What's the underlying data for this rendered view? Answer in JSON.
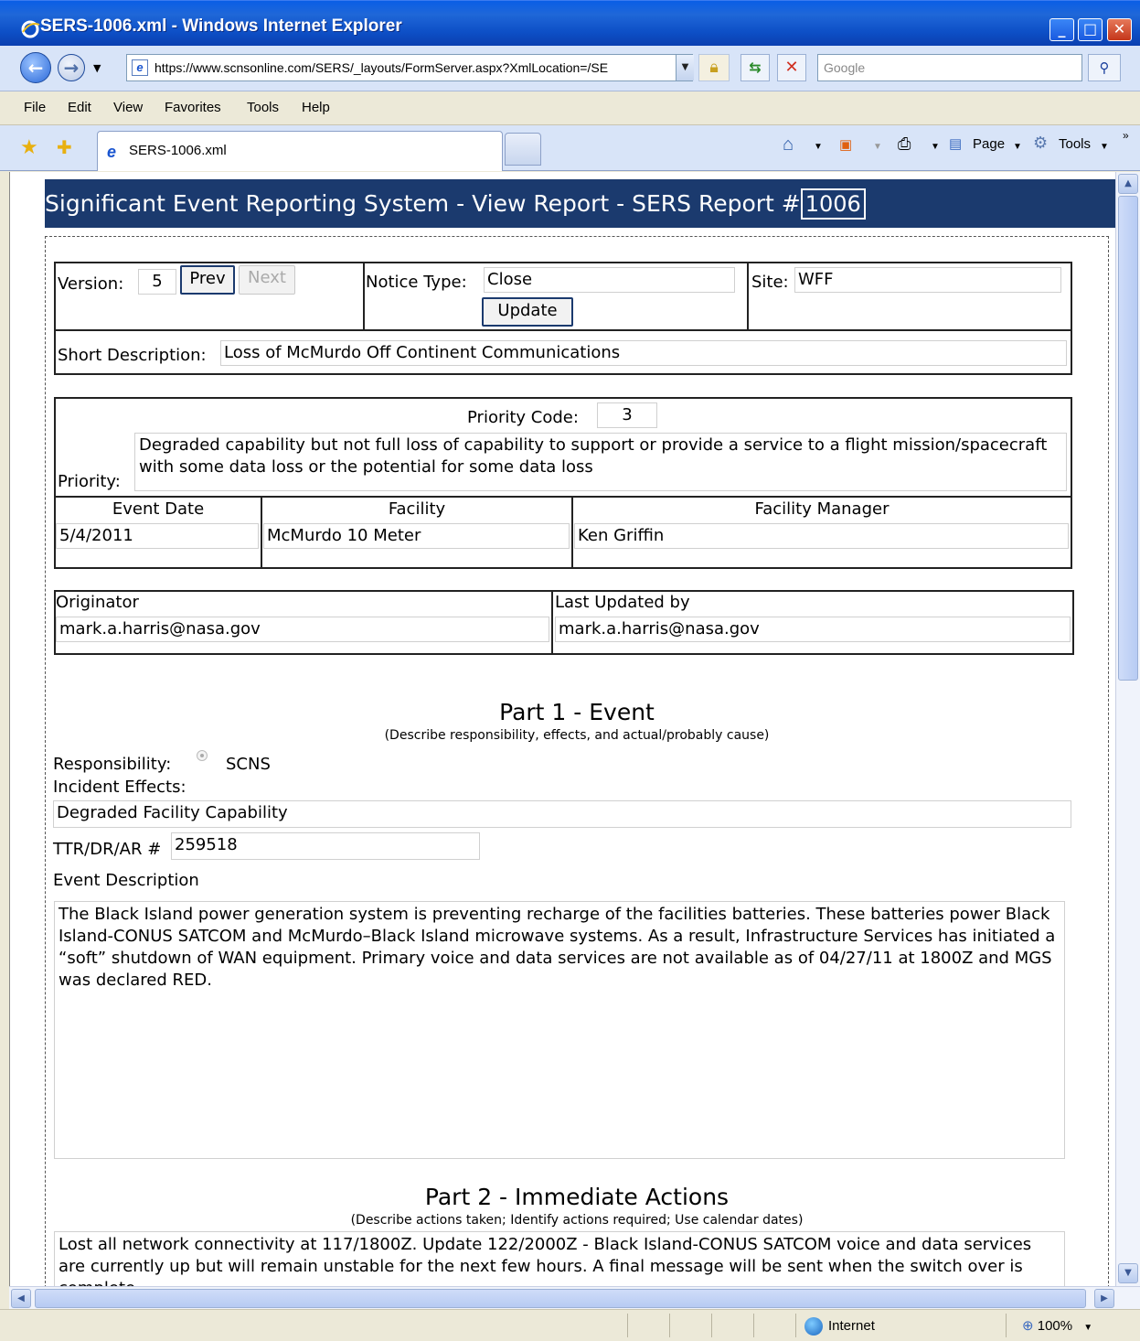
{
  "window": {
    "title": "SERS-1006.xml - Windows Internet Explorer",
    "min": "_",
    "max": "□",
    "close": "✕"
  },
  "address": {
    "url": "https://www.scnsonline.com/SERS/_layouts/FormServer.aspx?XmlLocation=/SE",
    "search_placeholder": "Google"
  },
  "menu": {
    "file": "File",
    "edit": "Edit",
    "view": "View",
    "favorites": "Favorites",
    "tools": "Tools",
    "help": "Help"
  },
  "tab": {
    "title": "SERS-1006.xml"
  },
  "commandbar": {
    "page": "Page",
    "tools": "Tools"
  },
  "status": {
    "zone": "Internet",
    "zoom": "100%"
  },
  "form": {
    "banner_prefix": "Significant Event Reporting System - View Report - SERS Report #",
    "report_number": "1006",
    "version_label": "Version:",
    "version": "5",
    "prev_label": "Prev",
    "next_label": "Next",
    "notice_type_label": "Notice Type:",
    "notice_type": "Close",
    "update_label": "Update",
    "site_label": "Site:",
    "site": "WFF",
    "short_desc_label": "Short Description:",
    "short_desc": "Loss of McMurdo Off Continent Communications",
    "priority_code_label": "Priority Code:",
    "priority_code": "3",
    "priority_label": "Priority:",
    "priority_text": "Degraded capability but not full loss of capability to support or provide a service to a flight mission/spacecraft with some data loss or the potential for some data loss",
    "event_date_label": "Event Date",
    "event_date": "5/4/2011",
    "facility_label": "Facility",
    "facility": "McMurdo 10 Meter",
    "facility_manager_label": "Facility Manager",
    "facility_manager": "Ken Griffin",
    "originator_label": "Originator",
    "originator": "mark.a.harris@nasa.gov",
    "last_updated_label": "Last Updated by",
    "last_updated": "mark.a.harris@nasa.gov",
    "part1_title": "Part 1 - Event",
    "part1_sub": "(Describe responsibility, effects, and actual/probably cause)",
    "responsibility_label": "Responsibility:",
    "responsibility": "SCNS",
    "incident_effects_label": "Incident Effects:",
    "incident_effects": "Degraded Facility Capability",
    "ttr_label": "TTR/DR/AR #",
    "ttr": "259518",
    "event_desc_label": "Event Description",
    "event_desc": "The Black Island power generation system is preventing recharge of the facilities batteries.  These batteries power Black Island-CONUS SATCOM and McMurdo–Black Island microwave systems.  As a result, Infrastructure Services has initiated a “soft” shutdown of WAN equipment.  Primary voice and data services are not available as of 04/27/11 at 1800Z and MGS was declared RED.",
    "part2_title": "Part 2 - Immediate Actions",
    "part2_sub": "(Describe actions taken; Identify actions required; Use calendar dates)",
    "immediate_actions": "Lost all network connectivity at 117/1800Z.  Update 122/2000Z -  Black Island-CONUS SATCOM voice and data services are currently up but will remain unstable for the next few hours. A final message will be sent when the switch over is complete."
  }
}
